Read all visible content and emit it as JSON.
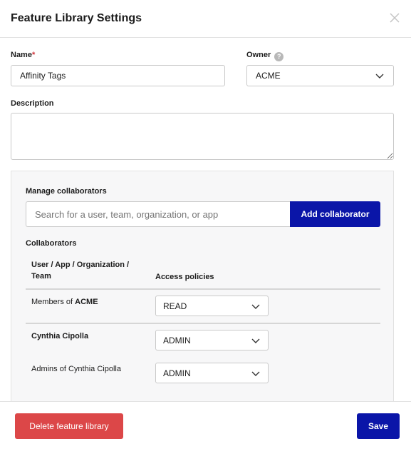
{
  "modal": {
    "title": "Feature Library Settings",
    "close_icon": "close-icon"
  },
  "form": {
    "name_label": "Name",
    "required_mark": "*",
    "name_value": "Affinity Tags",
    "owner_label": "Owner",
    "owner_help": "?",
    "owner_value": "ACME",
    "description_label": "Description",
    "description_value": ""
  },
  "collaborators_panel": {
    "manage_label": "Manage collaborators",
    "search_placeholder": "Search for a user, team, organization, or app",
    "add_button": "Add collaborator",
    "collaborators_label": "Collaborators",
    "column_user_line1": "User / App / Organization /",
    "column_user_line2": "Team",
    "column_policy": "Access policies",
    "rows": [
      {
        "prefix": "Members of ",
        "name": "ACME",
        "policy": "READ"
      },
      {
        "prefix": "",
        "name": "Cynthia Cipolla",
        "policy": "ADMIN"
      },
      {
        "prefix": "Admins of Cynthia Cipolla",
        "name": "",
        "policy": "ADMIN"
      }
    ]
  },
  "footer": {
    "delete_button": "Delete feature library",
    "save_button": "Save"
  },
  "colors": {
    "primary": "#0a15a8",
    "danger": "#dc4748",
    "required": "#d0333a"
  }
}
